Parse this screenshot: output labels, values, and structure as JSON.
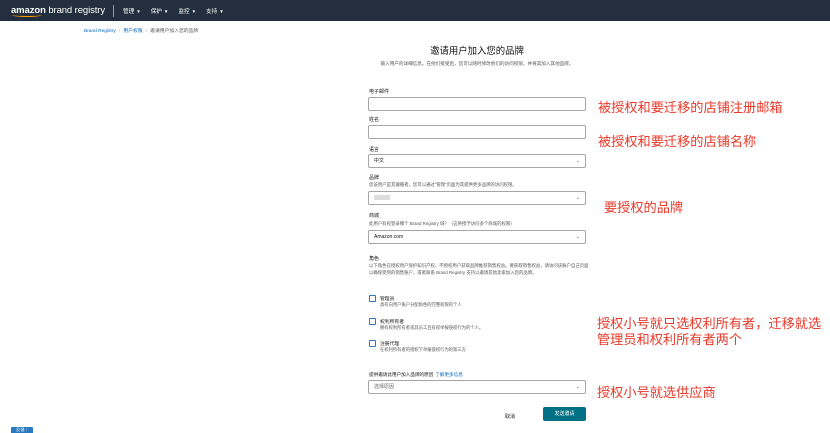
{
  "header": {
    "logo_bold": "amazon",
    "logo_light": " brand registry",
    "nav": [
      "管理",
      "保护",
      "监控",
      "支持"
    ]
  },
  "breadcrumb": {
    "items": [
      "Brand Registry",
      "用户权限",
      "邀请用户加入您的品牌"
    ]
  },
  "form": {
    "title": "邀请用户加入您的品牌",
    "intro": "输入用户的详细信息。在他们接受后，您可以随时修改他们的访问权限，并将其加入其他品牌。",
    "email_label": "电子邮件",
    "email_value": "",
    "name_label": "姓名",
    "name_value": "",
    "language_label": "语言",
    "language_value": "中文",
    "brand_label": "品牌",
    "brand_hint": "您该用户是其遵循者，您可以通过“管理”页面为其提供更多品牌的访问权限。",
    "marketplace_label": "商城",
    "marketplace_hint": "此用户有权登录哪个 Brand Registry 域？（这将授予访问多个商城的权限）",
    "marketplace_value": "Amazon.com",
    "roles_label": "角色",
    "roles_desc": "以下角色在授权用户保护知识产权、不授权用户获取品牌推荐销售权益。要获取销售权益，请访问该账户自己页面以确保受到的销售账户，或者联系 Brand Registry 支持以邀请其他卖家加入您的品牌。",
    "roles": [
      {
        "title": "管理员",
        "desc": "具有向用户账户分配角色的完整权限的个人",
        "checked": false
      },
      {
        "title": "权利所有者",
        "desc": "拥有权利所有者或其员工且有权举报侵权行为的个人。",
        "checked": false
      },
      {
        "title": "注册代理",
        "desc": "在权利所有者的授权下举报侵权行为的第三方",
        "checked": false
      }
    ],
    "reason_label": "提供邀请此用户加入品牌的原因",
    "reason_link": "了解更多信息",
    "reason_placeholder": "选择原因",
    "cancel_label": "取消",
    "send_label": "发送邀请"
  },
  "annotations": {
    "email": "被授权和要迁移的店铺注册邮箱",
    "name": "被授权和要迁移的店铺名称",
    "brand": "要授权的品牌",
    "roles_line1": "授权小号就只选权利所有者，迁移就选",
    "roles_line2": "管理员和权利所有者两个",
    "reason": "授权小号就选供应商"
  },
  "feedback_label": "反馈 ↑",
  "colors": {
    "topbar": "#232f3e",
    "accent": "#007185",
    "link": "#0066c0",
    "annotation": "#e8392a"
  }
}
